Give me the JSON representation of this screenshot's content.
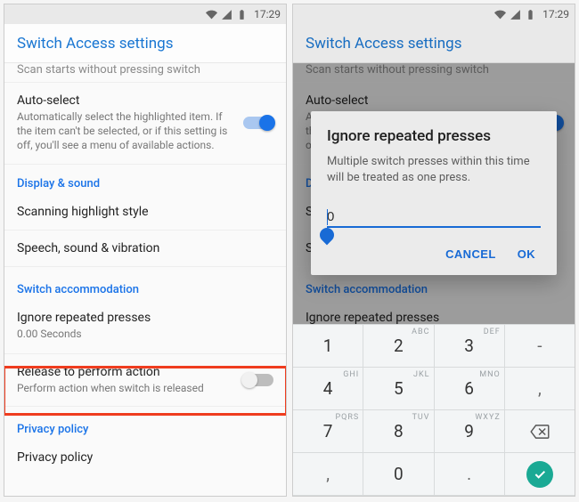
{
  "status": {
    "time": "17:29"
  },
  "header": {
    "title": "Switch Access settings"
  },
  "faded_row": "Scan starts without pressing switch",
  "rows": {
    "auto_select": {
      "title": "Auto-select",
      "sub": "Automatically select the highlighted item. If the item can't be selected, or if this setting is off, you'll see a menu of available actions.",
      "on": true
    },
    "display_section": "Display & sound",
    "highlight_style": "Scanning highlight style",
    "speech": "Speech, sound & vibration",
    "accommodation_section": "Switch accommodation",
    "ignore": {
      "title": "Ignore repeated presses",
      "sub": "0.00 Seconds"
    },
    "release": {
      "title": "Release to perform action",
      "sub": "Perform action when switch is released",
      "on": false
    },
    "privacy_section": "Privacy policy",
    "privacy_item": "Privacy policy"
  },
  "dialog": {
    "title": "Ignore repeated presses",
    "body": "Multiple switch presses within this time will be treated as one press.",
    "value": "0",
    "cancel": "CANCEL",
    "ok": "OK"
  },
  "keypad": {
    "r1": [
      "1",
      "2",
      "3",
      "-"
    ],
    "r2": [
      "4",
      "5",
      "6",
      ","
    ],
    "r3": [
      "7",
      "8",
      "9",
      "⌫"
    ],
    "r4": [
      ",",
      "0",
      ".",
      "✓"
    ],
    "super1": "",
    "super2": "ABC",
    "super3": "DEF",
    "super4": "GHI",
    "super5": "JKL",
    "super6": "MNO",
    "super7": "PQRS",
    "super8": "TUV",
    "super9": "WXYZ"
  }
}
